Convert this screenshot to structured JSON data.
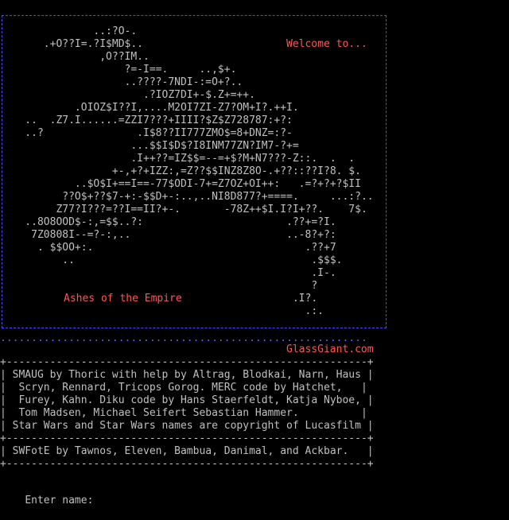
{
  "art_lines": [
    "               ..:?O-.",
    "       .+O??I=.?I$MD$..",
    "                ,O??IM..",
    "                    ?=-I==.     ..,$+.",
    "                    ..????-7NDI-:=O+?..",
    "                       .?IOZ7DI+-$.Z+=++.",
    "            .OIOZ$I??I,....M2OI7ZI-Z7?OM+I?.++I.",
    "    ..  .Z7.I......=ZZI7???+IIII?$Z$Z728787:+?:",
    "    ..?               .I$8??II777ZMO$=8+DNZ=:?-",
    "                     ...$$I$D$?I8INM77ZN?IM7-?+=",
    "                     .I++??=IZ$$=--=+$?M+N7???-Z::.  .  .",
    "                  +-,+?+IZZ:,=Z??$$INZ8Z8O-.+??::??I?8. $.",
    "            ..$O$I+==I==-77$ODI-7+=Z7OZ+OI++:   .=?+?+?$II",
    "          ??O$+??$7-+:-$$D+-:..,..NI8D877?+====.     ...:?..",
    "         Z77?I???=??I==II?+-.       -78Z++$I.I?I+??.    7$.",
    "    ..8O8OOD$-:,=$$..?:                       .??+=?I.",
    "     7Z0808I--=?-:,..                         ..-8?+?:",
    "      . $$OO+:.                                  .??+7",
    "          ..                                      .$$$.",
    "                                                  .I-.",
    "                                                  ?",
    "                                               .I?.",
    "                                                 .:."
  ],
  "welcome_text": "Welcome to...",
  "game_title": "Ashes of the Empire",
  "site_name": "GlassGiant.com",
  "dots_line": "...........................................................",
  "separator": "+----------------------------------------------------------+",
  "credits": [
    "| SMAUG by Thoric with help by Altrag, Blodkai, Narn, Haus |",
    "|  Scryn, Rennard, Tricops Gorog. MERC code by Hatchet,   |",
    "|  Furey, Kahn. Diku code by Hans Staerfeldt, Katja Nyboe, |",
    "|  Tom Madsen, Michael Seifert Sebastian Hammer.          |",
    "| Star Wars and Star Wars names are copyright of Lucasfilm |"
  ],
  "swfote": "| SWFotE by Tawnos, Eleven, Bambua, Danimal, and Ackbar.   |",
  "prompt": "Enter name: "
}
